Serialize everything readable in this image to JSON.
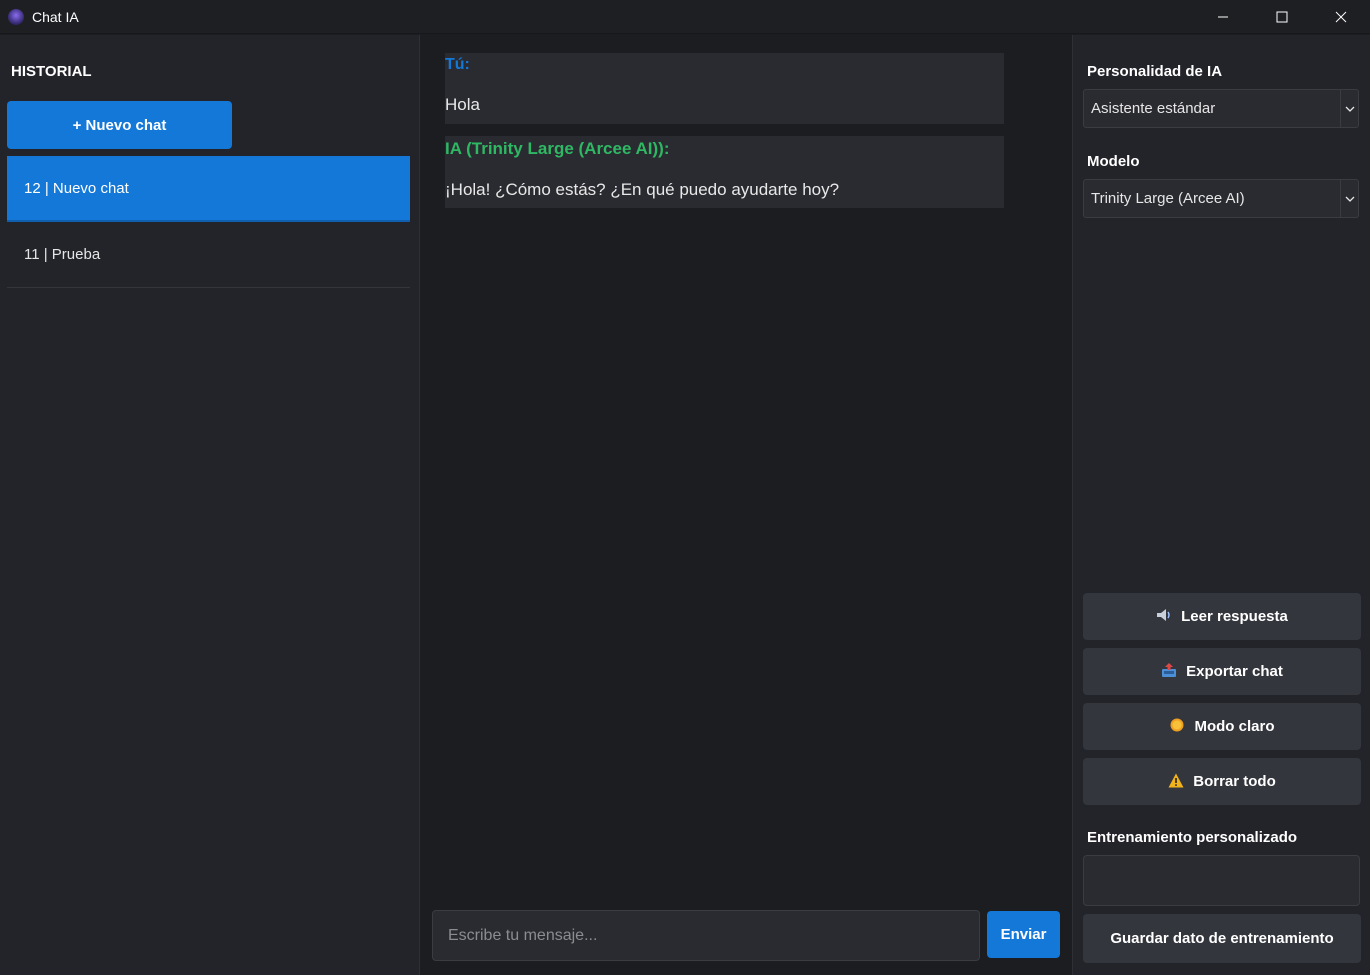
{
  "window": {
    "title": "Chat IA",
    "icons": {
      "app": "app-icon",
      "minimize": "minimize-icon",
      "maximize": "maximize-icon",
      "close": "close-icon"
    }
  },
  "sidebar": {
    "title": "HISTORIAL",
    "new_chat_label": "+ Nuevo chat",
    "chats": [
      {
        "label": "12 | Nuevo chat",
        "active": true
      },
      {
        "label": "11 | Prueba",
        "active": false
      }
    ]
  },
  "conversation": {
    "messages": [
      {
        "role": "user",
        "author": "Tú:",
        "text": "Hola"
      },
      {
        "role": "ai",
        "author": "IA (Trinity Large (Arcee AI)):",
        "text": "¡Hola! ¿Cómo estás? ¿En qué puedo ayudarte hoy?"
      }
    ],
    "input_placeholder": "Escribe tu mensaje...",
    "send_label": "Enviar"
  },
  "settings": {
    "personality_label": "Personalidad de IA",
    "personality_value": "Asistente estándar",
    "model_label": "Modelo",
    "model_value": "Trinity Large (Arcee AI)",
    "actions": {
      "read": {
        "label": "Leer respuesta",
        "icon": "speaker-icon"
      },
      "export": {
        "label": "Exportar chat",
        "icon": "outbox-icon"
      },
      "light": {
        "label": "Modo claro",
        "icon": "sun-icon"
      },
      "clear": {
        "label": "Borrar todo",
        "icon": "warning-icon"
      }
    },
    "training_label": "Entrenamiento personalizado",
    "training_value": "",
    "save_training_label": "Guardar dato de entrenamiento"
  },
  "colors": {
    "accent": "#1478d8",
    "user_author": "#1478d8",
    "ai_author": "#2fb864",
    "background": "#1c1d21",
    "panel": "#23242a",
    "button": "#34363d"
  }
}
